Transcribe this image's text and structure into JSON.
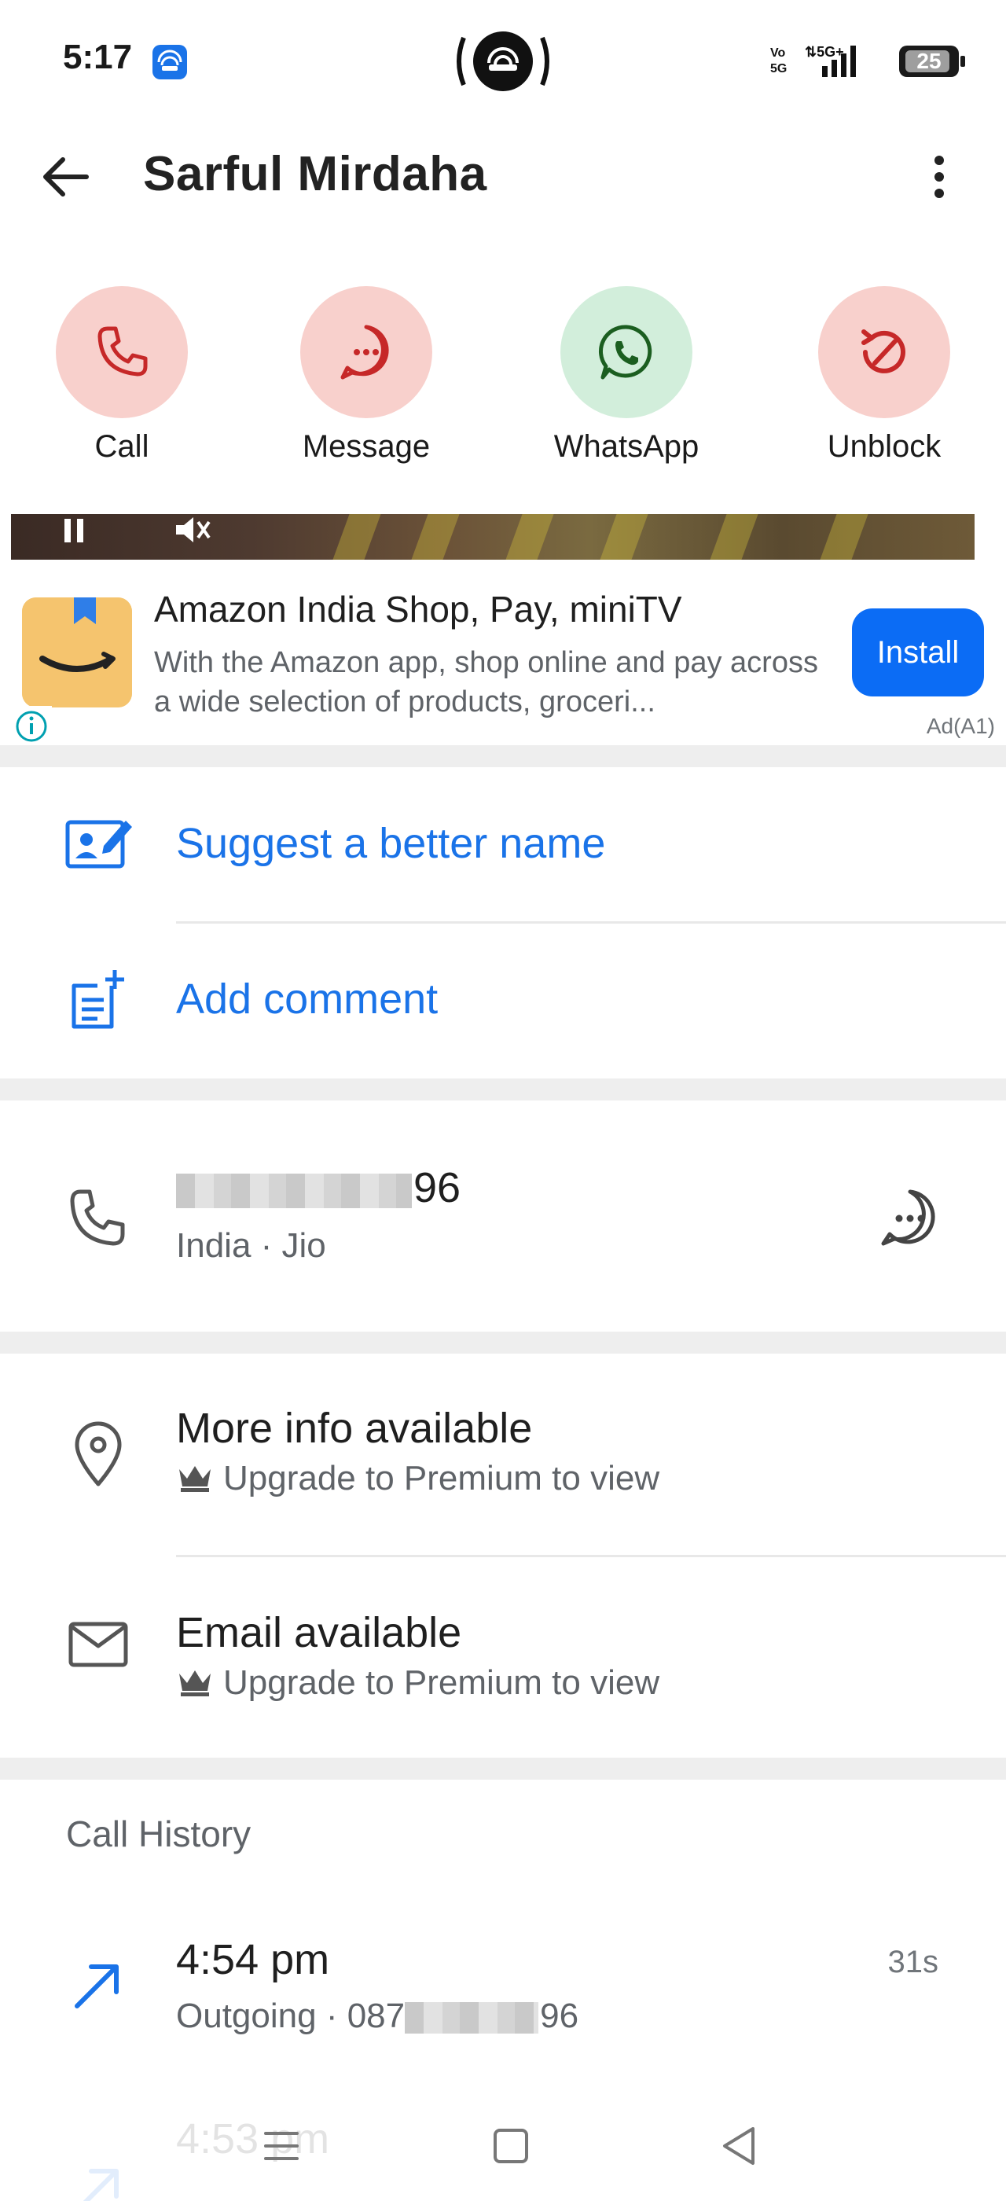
{
  "status_bar": {
    "time": "5:17",
    "battery": "25"
  },
  "header": {
    "contact_name": "Sarful Mirdaha"
  },
  "actions": [
    {
      "label": "Call",
      "icon": "phone-icon",
      "color": "#f8d0cc",
      "icon_color": "#c62828"
    },
    {
      "label": "Message",
      "icon": "message-icon",
      "color": "#f8d0cc",
      "icon_color": "#c62828"
    },
    {
      "label": "WhatsApp",
      "icon": "whatsapp-icon",
      "color": "#d2eedb",
      "icon_color": "#1b5e20"
    },
    {
      "label": "Unblock",
      "icon": "unblock-icon",
      "color": "#f8d0cc",
      "icon_color": "#c62828"
    }
  ],
  "ad": {
    "title": "Amazon India Shop, Pay, miniTV",
    "description": "With the Amazon app, shop online and pay across a wide selection of products, groceri...",
    "cta": "Install",
    "tag": "Ad(A1)"
  },
  "options": {
    "suggest_name": "Suggest a better name",
    "add_comment": "Add comment"
  },
  "phone": {
    "number_suffix": "96",
    "details": "India · Jio"
  },
  "more_info": {
    "title": "More info available",
    "subtitle": "Upgrade to Premium to view"
  },
  "email_info": {
    "title": "Email available",
    "subtitle": "Upgrade to Premium to view"
  },
  "call_history": {
    "title": "Call History",
    "entries": [
      {
        "time": "4:54 pm",
        "type": "Outgoing",
        "number_prefix": "087",
        "number_suffix": "96",
        "duration": "31s"
      },
      {
        "time": "4:53 pm"
      }
    ]
  },
  "colors": {
    "accent": "#1a73e8",
    "install_button": "#0b6cf5",
    "section_band": "#eeeeee"
  }
}
